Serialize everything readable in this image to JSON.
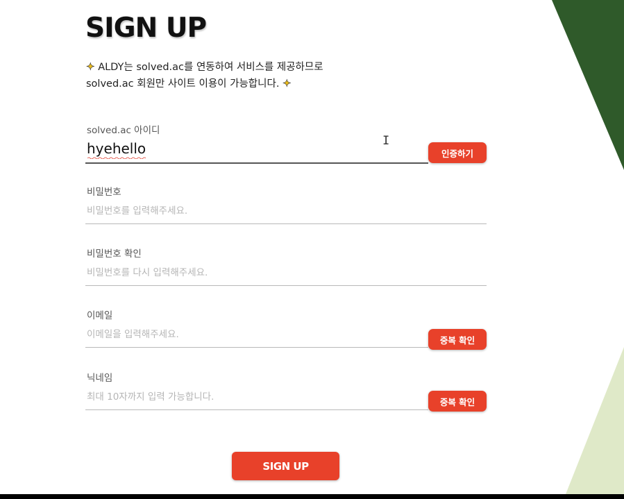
{
  "colors": {
    "accent": "#e8412a",
    "dark_green": "#2f5a2a",
    "light_green": "#d9e8c2"
  },
  "page": {
    "title": "SIGN UP",
    "intro_line1": "ALDY는 solved.ac를 연동하여 서비스를 제공하므로",
    "intro_line2": "solved.ac 회원만 사이트 이용이 가능합니다.",
    "sparkle_glyph": "✦"
  },
  "form": {
    "id": {
      "label": "solved.ac 아이디",
      "value": "hyehello",
      "placeholder": "",
      "button": "인증하기"
    },
    "password": {
      "label": "비밀번호",
      "value": "",
      "placeholder": "비밀번호를 입력해주세요."
    },
    "password_confirm": {
      "label": "비밀번호 확인",
      "value": "",
      "placeholder": "비밀번호를 다시 입력해주세요."
    },
    "email": {
      "label": "이메일",
      "value": "",
      "placeholder": "이메일을 입력해주세요.",
      "button": "중복 확인"
    },
    "nickname": {
      "label": "닉네임",
      "value": "",
      "placeholder": "최대 10자까지 입력 가능합니다.",
      "button": "중복 확인"
    },
    "submit": "SIGN UP"
  },
  "icons": {
    "sparkle": "sparkle-icon",
    "text_cursor": "i-beam-cursor-icon"
  }
}
